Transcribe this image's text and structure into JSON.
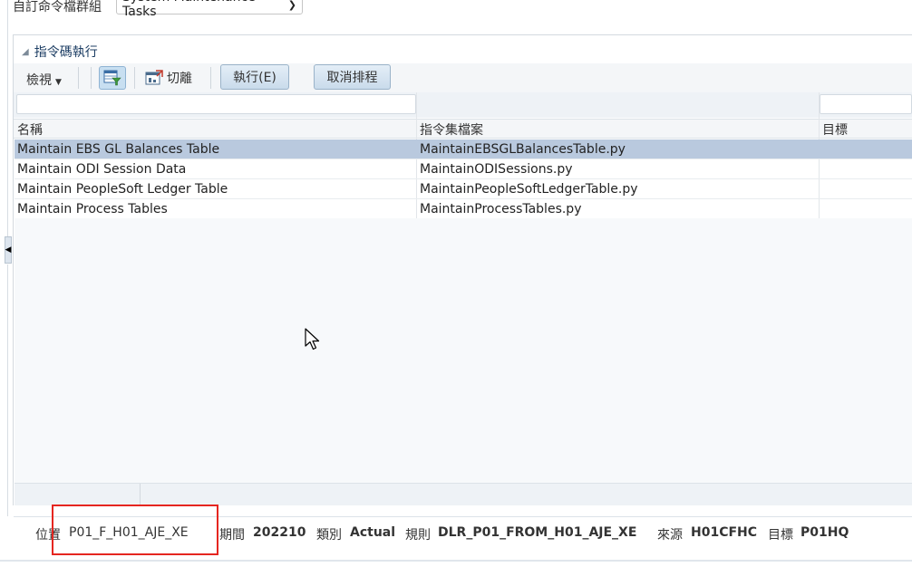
{
  "top": {
    "group_label": "自訂命令檔群組",
    "group_value": "System Maintenance Tasks"
  },
  "panel": {
    "title": "指令碼執行"
  },
  "toolbar": {
    "view_label": "檢視",
    "detach_label": "切離",
    "run_label": "執行(E)",
    "cancel_schedule_label": "取消排程"
  },
  "grid": {
    "columns": [
      "名稱",
      "指令集檔案",
      "目標"
    ],
    "rows": [
      {
        "name": "Maintain EBS GL Balances Table",
        "file": "MaintainEBSGLBalancesTable.py",
        "target": "",
        "selected": true
      },
      {
        "name": "Maintain ODI Session Data",
        "file": "MaintainODISessions.py",
        "target": "",
        "selected": false
      },
      {
        "name": "Maintain PeopleSoft Ledger Table",
        "file": "MaintainPeopleSoftLedgerTable.py",
        "target": "",
        "selected": false
      },
      {
        "name": "Maintain Process Tables",
        "file": "MaintainProcessTables.py",
        "target": "",
        "selected": false
      }
    ]
  },
  "status": {
    "location_label": "位置",
    "location_value": "P01_F_H01_AJE_XE",
    "period_label": "期間",
    "period_value": "202210",
    "category_label": "類別",
    "category_value": "Actual",
    "rule_label": "規則",
    "rule_value": "DLR_P01_FROM_H01_AJE_XE",
    "source_label": "來源",
    "source_value": "H01CFHC",
    "target_label": "目標",
    "target_value": "P01HQ"
  },
  "colors": {
    "selected_row": "#b9c9de",
    "highlight_box": "#e52620",
    "link_text": "#1f3d66"
  }
}
